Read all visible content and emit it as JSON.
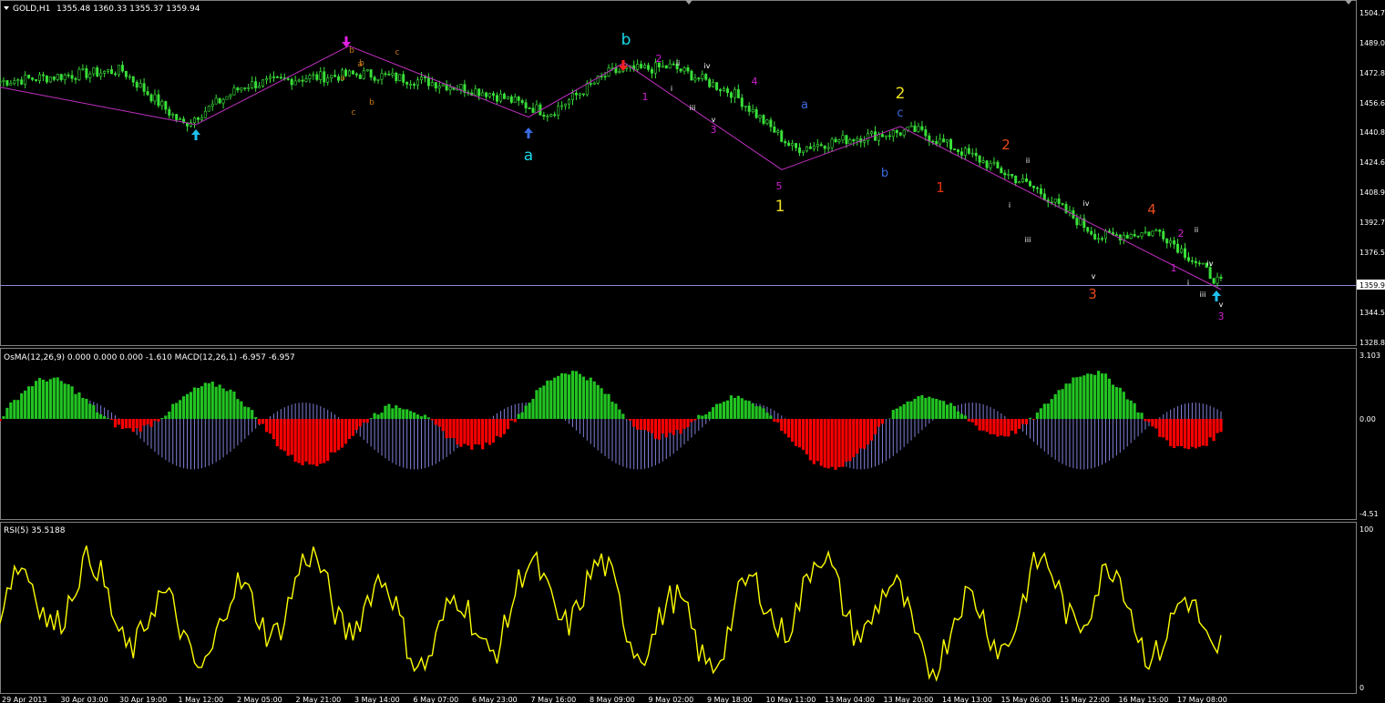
{
  "window": {
    "symbol_label": "GOLD,H1",
    "ohlc_text": "1355.48 1360.33 1355.37 1359.94"
  },
  "price_axis": {
    "ticks": [
      "1504.7",
      "1489.0",
      "1472.8",
      "1456.6",
      "1440.8",
      "1424.6",
      "1408.9",
      "1392.7",
      "1376.5",
      "1360.3",
      "1344.5",
      "1328.8"
    ],
    "current_price": "1359.94",
    "current_price_label": "1359.9",
    "range": [
      1328.8,
      1504.7
    ]
  },
  "osma_panel": {
    "header": "OsMA(12,26,9) 0.000 0.000 0.000 -1.610  MACD(12,26,1) -6.957 -6.957",
    "ticks": [
      "3.103",
      "0.00",
      "-4.51"
    ],
    "range": [
      -4.51,
      3.103
    ]
  },
  "rsi_panel": {
    "header": "RSI(5) 35.5188",
    "ticks": [
      "100",
      "0"
    ],
    "range": [
      0,
      100
    ]
  },
  "time_axis": {
    "labels": [
      "29 Apr 2013",
      "30 Apr 03:00",
      "30 Apr 19:00",
      "1 May 12:00",
      "2 May 05:00",
      "2 May 21:00",
      "3 May 14:00",
      "6 May 07:00",
      "6 May 23:00",
      "7 May 16:00",
      "8 May 09:00",
      "9 May 02:00",
      "9 May 18:00",
      "10 May 11:00",
      "13 May 04:00",
      "13 May 20:00",
      "14 May 13:00",
      "15 May 06:00",
      "15 May 22:00",
      "16 May 15:00",
      "17 May 08:00"
    ]
  },
  "wave_labels": [
    {
      "text": "b",
      "color": "#19d8e8"
    },
    {
      "text": "a",
      "color": "#19d8e8"
    },
    {
      "text": "1",
      "color": "#f0e020"
    },
    {
      "text": "2",
      "color": "#f0e020"
    },
    {
      "text": "a",
      "color": "#3a6ae0"
    },
    {
      "text": "b",
      "color": "#3a6ae0"
    },
    {
      "text": "c",
      "color": "#3a6ae0"
    },
    {
      "text": "1",
      "color": "#e83010"
    },
    {
      "text": "2",
      "color": "#e84a18"
    },
    {
      "text": "3",
      "color": "#e84a18"
    },
    {
      "text": "4",
      "color": "#e84a18"
    },
    {
      "text": "1",
      "color": "#d020d0"
    },
    {
      "text": "2",
      "color": "#d020d0"
    },
    {
      "text": "3",
      "color": "#d020d0"
    },
    {
      "text": "4",
      "color": "#d020d0"
    },
    {
      "text": "5",
      "color": "#d020d0"
    },
    {
      "text": "1",
      "color": "#d020d0"
    },
    {
      "text": "2",
      "color": "#d020d0"
    },
    {
      "text": "3",
      "color": "#d020d0"
    },
    {
      "text": "a",
      "color": "#c87818"
    },
    {
      "text": "b",
      "color": "#c87818"
    },
    {
      "text": "c",
      "color": "#c87818"
    },
    {
      "text": "a",
      "color": "#c87818"
    },
    {
      "text": "b",
      "color": "#c87818"
    },
    {
      "text": "c",
      "color": "#c87818"
    },
    {
      "text": "b",
      "color": "#c87818"
    },
    {
      "text": "i",
      "color": "#ffffff"
    },
    {
      "text": "ii",
      "color": "#ffffff"
    },
    {
      "text": "iii",
      "color": "#ffffff"
    },
    {
      "text": "iv",
      "color": "#ffffff"
    },
    {
      "text": "v",
      "color": "#ffffff"
    },
    {
      "text": "i",
      "color": "#ffffff"
    },
    {
      "text": "ii",
      "color": "#ffffff"
    },
    {
      "text": "iii",
      "color": "#ffffff"
    },
    {
      "text": "iv",
      "color": "#ffffff"
    },
    {
      "text": "v",
      "color": "#ffffff"
    },
    {
      "text": "i",
      "color": "#ffffff"
    },
    {
      "text": "ii",
      "color": "#ffffff"
    },
    {
      "text": "iii",
      "color": "#ffffff"
    },
    {
      "text": "iv",
      "color": "#ffffff"
    },
    {
      "text": "v",
      "color": "#ffffff"
    }
  ],
  "colors": {
    "candle": "#39e039",
    "zigzag": "#c030c0",
    "osma_pos": "#22c422",
    "osma_neg": "#ff0000",
    "macd_hist": "#8080d8",
    "rsi_line": "#ffff00",
    "grid": "#ffffff"
  },
  "chart_data": [
    {
      "type": "candlestick",
      "title": "GOLD,H1",
      "ylim": [
        1328.8,
        1504.7
      ],
      "x_start": "29 Apr 2013",
      "x_end": "17 May 2013",
      "close_path": [
        {
          "x": "29 Apr 2013",
          "y": 1468
        },
        {
          "x": "30 Apr 03:00",
          "y": 1471
        },
        {
          "x": "30 Apr 19:00",
          "y": 1474
        },
        {
          "x": "1 May 12:00",
          "y": 1445
        },
        {
          "x": "2 May 05:00",
          "y": 1466
        },
        {
          "x": "2 May 21:00",
          "y": 1470
        },
        {
          "x": "3 May 14:00",
          "y": 1472
        },
        {
          "x": "6 May 07:00",
          "y": 1468
        },
        {
          "x": "6 May 23:00",
          "y": 1462
        },
        {
          "x": "7 May 16:00",
          "y": 1451
        },
        {
          "x": "8 May 09:00",
          "y": 1473
        },
        {
          "x": "9 May 02:00",
          "y": 1476
        },
        {
          "x": "9 May 18:00",
          "y": 1462
        },
        {
          "x": "10 May 11:00",
          "y": 1432
        },
        {
          "x": "13 May 04:00",
          "y": 1438
        },
        {
          "x": "13 May 20:00",
          "y": 1442
        },
        {
          "x": "14 May 13:00",
          "y": 1427
        },
        {
          "x": "15 May 06:00",
          "y": 1410
        },
        {
          "x": "15 May 22:00",
          "y": 1385
        },
        {
          "x": "16 May 15:00",
          "y": 1388
        },
        {
          "x": "17 May 08:00",
          "y": 1360
        }
      ]
    },
    {
      "type": "bar",
      "title": "OsMA(12,26,9)",
      "ylim": [
        -4.51,
        3.103
      ]
    },
    {
      "type": "line",
      "title": "RSI(5)",
      "ylim": [
        0,
        100
      ],
      "last_value": 35.5188
    }
  ]
}
